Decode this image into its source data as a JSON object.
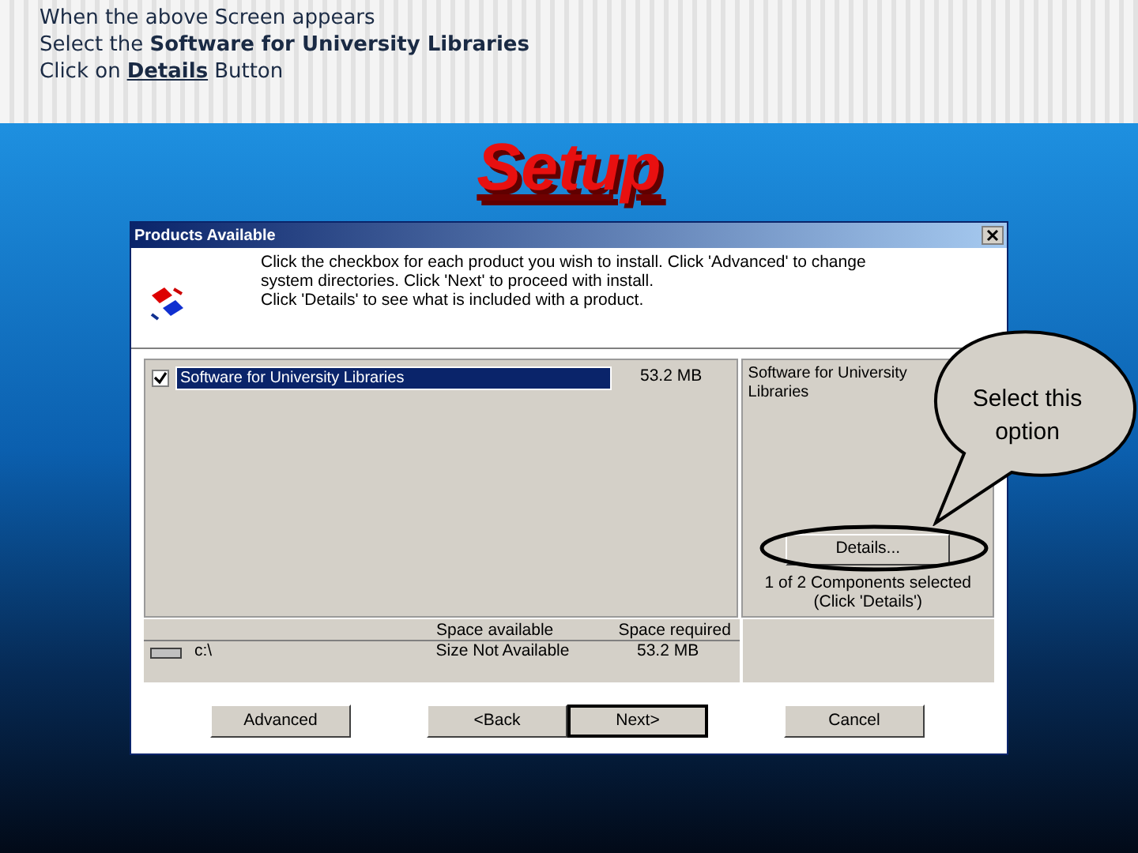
{
  "instructions": [
    {
      "text": "When the above Screen appears"
    },
    {
      "text": "Select the **Software for University Libraries**"
    },
    {
      "text": "Click on",
      "link": "Details",
      "after": "Button"
    }
  ],
  "slide_title": "Setup",
  "dialog": {
    "title": "Products Available",
    "message": [
      "Click the checkbox for each product you wish to install.  Click 'Advanced' to change",
      "system directories.  Click 'Next' to proceed with install.",
      "Click 'Details' to see what is included with a product."
    ],
    "products": [
      {
        "name": "Software for University Libraries",
        "size": "53.2 MB",
        "checked": true,
        "selected": true
      }
    ],
    "description": "Software for University Libraries",
    "details_button": "Details...",
    "components_note": [
      "1 of 2 Components selected",
      "(Click 'Details')"
    ],
    "disk": {
      "columns": [
        "Space available",
        "Space required"
      ],
      "rows": [
        {
          "drive": "c:\\",
          "available": "Size Not Available",
          "required": "53.2 MB"
        }
      ]
    },
    "buttons": [
      {
        "label": "Advanced",
        "default": false
      },
      {
        "label": "<Back",
        "default": false
      },
      {
        "label": "Next>",
        "default": true
      },
      {
        "label": "Cancel",
        "default": false
      }
    ]
  },
  "callout": {
    "text": "Select this option"
  }
}
